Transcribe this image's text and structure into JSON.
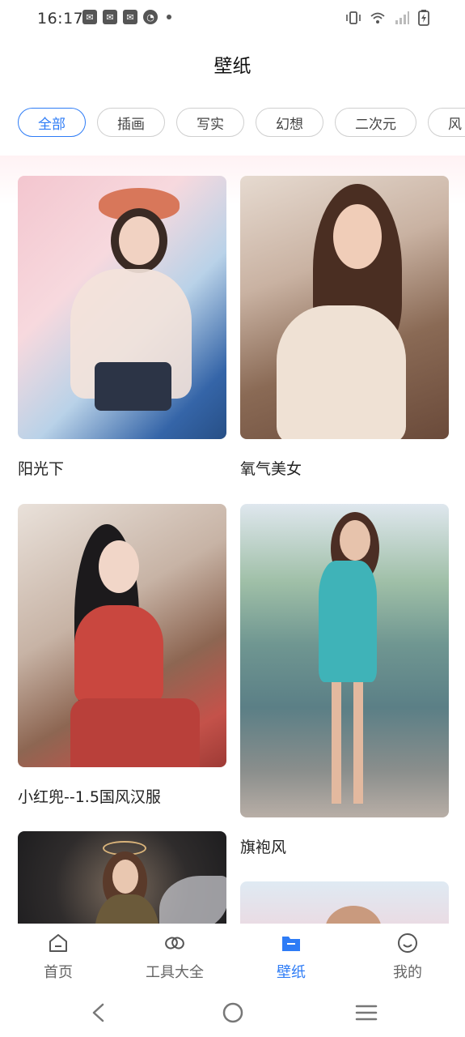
{
  "status_bar": {
    "time": "16:17",
    "notification_icons": [
      "mail-icon",
      "mail-icon",
      "mail-icon",
      "speed-icon"
    ],
    "system_icons": [
      "vibrate-icon",
      "wifi-icon",
      "signal-icon",
      "battery-charging-icon"
    ]
  },
  "header": {
    "title": "壁纸"
  },
  "filters": {
    "active_index": 0,
    "items": [
      {
        "label": "全部"
      },
      {
        "label": "插画"
      },
      {
        "label": "写实"
      },
      {
        "label": "幻想"
      },
      {
        "label": "二次元"
      },
      {
        "label": "风"
      }
    ]
  },
  "feed": {
    "cards": [
      {
        "title": "阳光下"
      },
      {
        "title": "氧气美女"
      },
      {
        "title": "小红兜--1.5国风汉服"
      },
      {
        "title": "旗袍风"
      },
      {
        "title": ""
      },
      {
        "title": ""
      }
    ]
  },
  "bottom_nav": {
    "active_index": 2,
    "accent_color": "#2e7cf6",
    "items": [
      {
        "label": "首页",
        "icon": "home-icon"
      },
      {
        "label": "工具大全",
        "icon": "tools-icon"
      },
      {
        "label": "壁纸",
        "icon": "folder-icon"
      },
      {
        "label": "我的",
        "icon": "smiley-icon"
      }
    ]
  },
  "system_nav": [
    "back-icon",
    "home-circle-icon",
    "menu-icon"
  ]
}
